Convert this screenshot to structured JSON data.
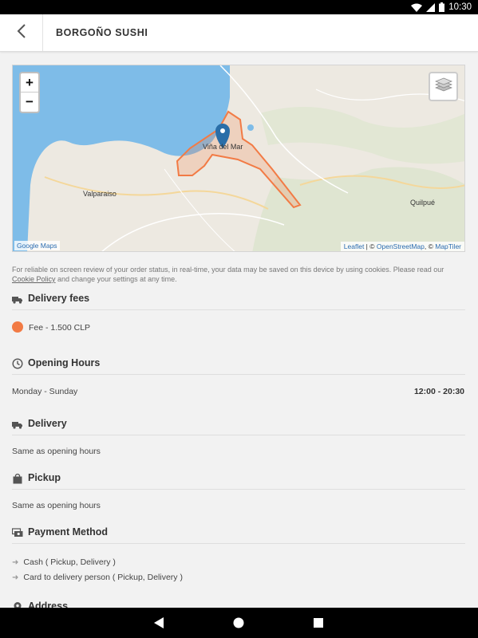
{
  "status_bar": {
    "time": "10:30"
  },
  "header": {
    "title": "BORGOÑO SUSHI"
  },
  "map": {
    "zoom_in": "+",
    "zoom_out": "−",
    "labels": {
      "city_center": "Viña del Mar",
      "valparaiso": "Valparaiso",
      "quilpue": "Quilpué"
    },
    "attribution_left": "Google Maps",
    "attribution_leaflet": "Leaflet",
    "attribution_sep1": " | © ",
    "attribution_osm": "OpenStreetMap",
    "attribution_sep2": ", © ",
    "attribution_maptiler": "MapTiler",
    "colors": {
      "water": "#7ebce8",
      "land": "#ede9e1",
      "zone": "#f27b45",
      "marker": "#2a6ea8"
    }
  },
  "cookie_notice": {
    "text_before": "For reliable on screen review of your order status, in real-time, your data may be saved on this device by using cookies. Please read our ",
    "link": "Cookie Policy",
    "text_after": " and change your settings at any time."
  },
  "delivery_fees": {
    "title": "Delivery fees",
    "fee": "Fee - 1.500 CLP",
    "fee_color": "#f27b45"
  },
  "opening_hours": {
    "title": "Opening Hours",
    "days": "Monday - Sunday",
    "time": "12:00 - 20:30"
  },
  "delivery": {
    "title": "Delivery",
    "text": "Same as opening hours"
  },
  "pickup": {
    "title": "Pickup",
    "text": "Same as opening hours"
  },
  "payment": {
    "title": "Payment Method",
    "methods": [
      "Cash ( Pickup, Delivery )",
      "Card to delivery person ( Pickup, Delivery )"
    ]
  },
  "address": {
    "title": "Address"
  }
}
